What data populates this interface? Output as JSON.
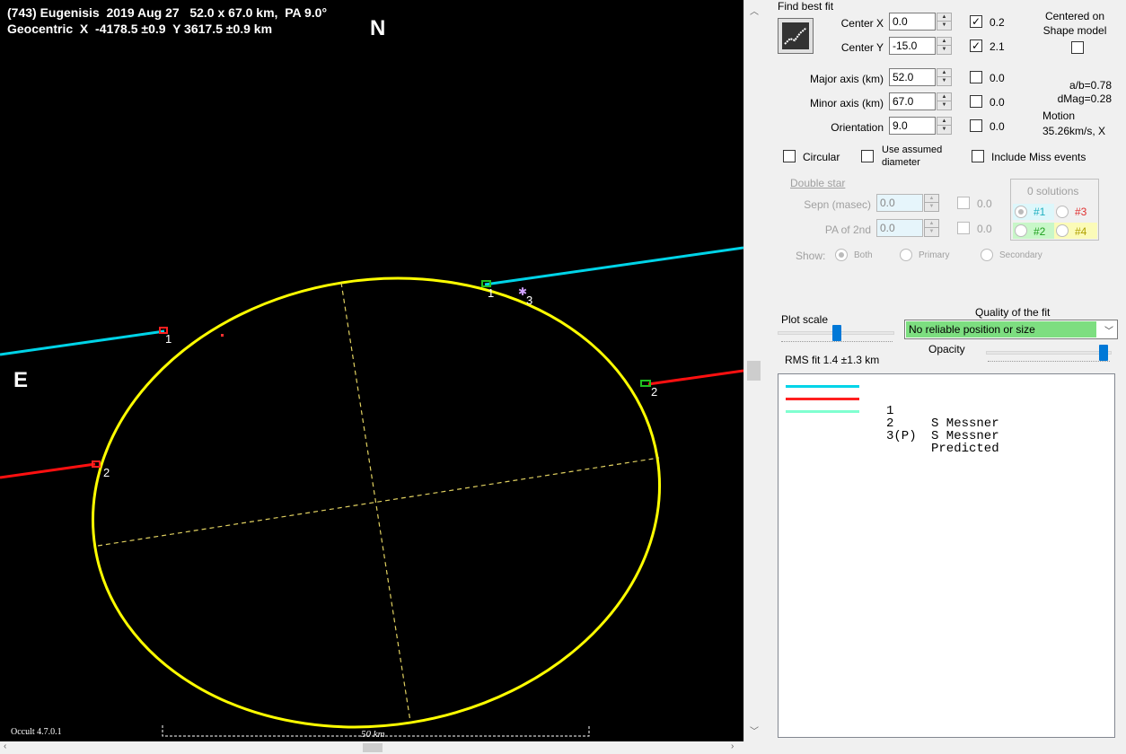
{
  "plot": {
    "title_line1": "(743) Eugenisis  2019 Aug 27   52.0 x 67.0 km,  PA 9.0°",
    "title_line2": "Geocentric  X  -4178.5 ±0.9  Y 3617.5 ±0.9 km",
    "north_label": "N",
    "east_label": "E",
    "version": "Occult 4.7.0.1",
    "scale_label": "50 km",
    "chord_labels": [
      "1",
      "2",
      "1",
      "3",
      "2"
    ],
    "colors": {
      "ellipse": "#ffff00",
      "chord1": "#00d4e8",
      "chord2": "#ff0000",
      "background": "#000000"
    }
  },
  "panel": {
    "find_best_fit": "Find best fit",
    "center_x_label": "Center X",
    "center_x_value": "0.0",
    "center_x_step": "0.2",
    "center_y_label": "Center Y",
    "center_y_value": "-15.0",
    "center_y_step": "2.1",
    "centered_on_label": "Centered on\nShape model",
    "major_axis_label": "Major axis (km)",
    "major_axis_value": "52.0",
    "major_axis_step": "0.0",
    "minor_axis_label": "Minor axis (km)",
    "minor_axis_value": "67.0",
    "minor_axis_step": "0.0",
    "orientation_label": "Orientation",
    "orientation_value": "9.0",
    "orientation_step": "0.0",
    "ab_ratio": "a/b=0.78",
    "dmag": "dMag=0.28",
    "motion_label": "Motion",
    "motion_value": "35.26km/s, X",
    "circular_label": "Circular",
    "use_assumed_label": "Use assumed\ndiameter",
    "include_miss_label": "Include Miss events",
    "double_star_label": "Double star",
    "sepn_label": "Sepn (masec)",
    "sepn_value": "0.0",
    "sepn_step": "0.0",
    "pa2_label": "PA of 2nd",
    "pa2_value": "0.0",
    "pa2_step": "0.0",
    "solutions_label": "0 solutions",
    "sol1": "#1",
    "sol2": "#2",
    "sol3": "#3",
    "sol4": "#4",
    "show_label": "Show:",
    "show_both": "Both",
    "show_primary": "Primary",
    "show_secondary": "Secondary",
    "plot_scale_label": "Plot scale",
    "quality_label": "Quality of the fit",
    "quality_value": "No reliable position or size",
    "opacity_label": "Opacity",
    "rms_fit": "RMS fit 1.4 ±1.3 km"
  },
  "legend": [
    {
      "num": "1",
      "name": "S Messner",
      "color": "#00d4e8"
    },
    {
      "num": "2",
      "name": "S Messner",
      "color": "#ff2020"
    },
    {
      "num": "3(P)",
      "name": "Predicted",
      "color": "#80ffd0"
    }
  ],
  "checks": {
    "center_x": true,
    "center_y": true
  }
}
